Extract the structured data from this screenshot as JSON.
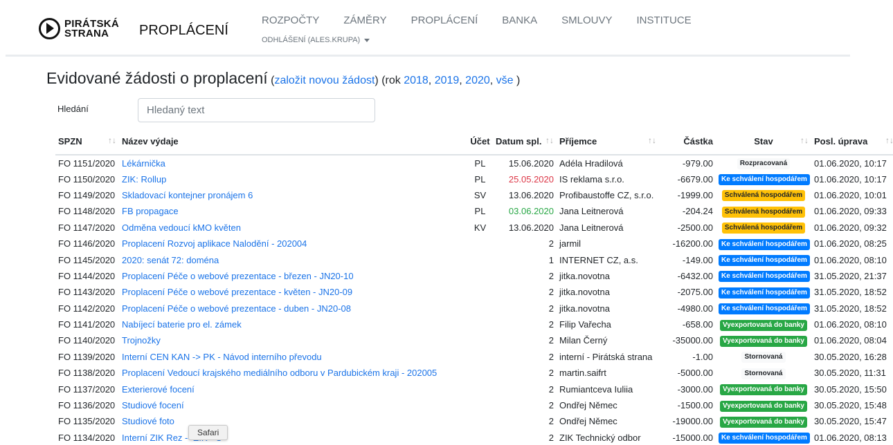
{
  "logo": {
    "line1": "PIRÁTSKÁ",
    "line2": "STRANA"
  },
  "brand": "PROPLÁCENÍ",
  "nav": [
    "ROZPOČTY",
    "ZÁMĚRY",
    "PROPLÁCENÍ",
    "BANKA",
    "SMLOUVY",
    "INSTITUCE"
  ],
  "user_menu": "ODHLÁŠENÍ (ALES.KRUPA)",
  "heading": {
    "title": "Evidované žádosti o proplacení",
    "open": " (",
    "new_link": "založit novou žádost",
    "rok": ") (rok ",
    "y2018": "2018",
    "y2019": "2019",
    "y2020": "2020",
    "all": "vše",
    "close": " )"
  },
  "search": {
    "label": "Hledání",
    "placeholder": "Hledaný text"
  },
  "columns": [
    "SPZN",
    "Název výdaje",
    "Účet",
    "Datum spl.",
    "Příjemce",
    "Částka",
    "Stav",
    "Posl. úprava"
  ],
  "rows": [
    {
      "spzn": "FO 1151/2020",
      "nazev": "Lékárnička",
      "ucet": "PL",
      "datum": "15.06.2020",
      "datum_color": "normal",
      "prijemce": "Adéla Hradilová",
      "castka": "-979.00",
      "stav": "Rozpracovaná",
      "stav_style": "gray",
      "posl": "01.06.2020, 10:17"
    },
    {
      "spzn": "FO 1150/2020",
      "nazev": "ZIK: Rollup",
      "ucet": "PL",
      "datum": "25.05.2020",
      "datum_color": "red",
      "prijemce": "IS reklama s.r.o.",
      "castka": "-6679.00",
      "stav": "Ke schválení hospodářem",
      "stav_style": "blue",
      "posl": "01.06.2020, 10:17"
    },
    {
      "spzn": "FO 1149/2020",
      "nazev": "Skladovací kontejner pronájem 6",
      "ucet": "SV",
      "datum": "13.06.2020",
      "datum_color": "normal",
      "prijemce": "Profibaustoffe CZ, s.r.o.",
      "castka": "-1999.00",
      "stav": "Schválená hospodářem",
      "stav_style": "yellow",
      "posl": "01.06.2020, 10:01"
    },
    {
      "spzn": "FO 1148/2020",
      "nazev": "FB propagace",
      "ucet": "PL",
      "datum": "03.06.2020",
      "datum_color": "green",
      "prijemce": "Jana Leitnerová",
      "castka": "-204.24",
      "stav": "Schválená hospodářem",
      "stav_style": "yellow",
      "posl": "01.06.2020, 09:33"
    },
    {
      "spzn": "FO 1147/2020",
      "nazev": "Odměna vedoucí kMO květen",
      "ucet": "KV",
      "datum": "13.06.2020",
      "datum_color": "normal",
      "prijemce": "Jana Leitnerová",
      "castka": "-2500.00",
      "stav": "Schválená hospodářem",
      "stav_style": "yellow",
      "posl": "01.06.2020, 09:32"
    },
    {
      "spzn": "FO 1146/2020",
      "nazev": "Proplacení Rozvoj aplikace Nalodění - 202004",
      "ucet": "",
      "datum": "2",
      "datum_color": "normal",
      "prijemce": "jarmil",
      "castka": "-16200.00",
      "stav": "Ke schválení hospodářem",
      "stav_style": "blue",
      "posl": "01.06.2020, 08:25"
    },
    {
      "spzn": "FO 1145/2020",
      "nazev": "2020: senát 72: doména",
      "ucet": "",
      "datum": "1",
      "datum_color": "normal",
      "prijemce": "INTERNET CZ, a.s.",
      "castka": "-149.00",
      "stav": "Ke schválení hospodářem",
      "stav_style": "blue",
      "posl": "01.06.2020, 08:10"
    },
    {
      "spzn": "FO 1144/2020",
      "nazev": "Proplacení Péče o webové prezentace - březen - JN20-10",
      "ucet": "",
      "datum": "2",
      "datum_color": "normal",
      "prijemce": "jitka.novotna",
      "castka": "-6432.00",
      "stav": "Ke schválení hospodářem",
      "stav_style": "blue",
      "posl": "31.05.2020, 21:37"
    },
    {
      "spzn": "FO 1143/2020",
      "nazev": "Proplacení Péče o webové prezentace - květen - JN20-09",
      "ucet": "",
      "datum": "2",
      "datum_color": "normal",
      "prijemce": "jitka.novotna",
      "castka": "-2075.00",
      "stav": "Ke schválení hospodářem",
      "stav_style": "blue",
      "posl": "31.05.2020, 18:52"
    },
    {
      "spzn": "FO 1142/2020",
      "nazev": "Proplacení Péče o webové prezentace - duben - JN20-08",
      "ucet": "",
      "datum": "2",
      "datum_color": "normal",
      "prijemce": "jitka.novotna",
      "castka": "-4980.00",
      "stav": "Ke schválení hospodářem",
      "stav_style": "blue",
      "posl": "31.05.2020, 18:52"
    },
    {
      "spzn": "FO 1141/2020",
      "nazev": "Nabíjecí baterie pro el. zámek",
      "ucet": "",
      "datum": "2",
      "datum_color": "normal",
      "prijemce": "Filip Vařecha",
      "castka": "-658.00",
      "stav": "Vyexportovaná do banky",
      "stav_style": "green",
      "posl": "01.06.2020, 08:10"
    },
    {
      "spzn": "FO 1140/2020",
      "nazev": "Trojnožky",
      "ucet": "",
      "datum": "2",
      "datum_color": "normal",
      "prijemce": "Milan Černý",
      "castka": "-35000.00",
      "stav": "Vyexportovaná do banky",
      "stav_style": "green",
      "posl": "01.06.2020, 08:04"
    },
    {
      "spzn": "FO 1139/2020",
      "nazev": "Interní CEN KAN -> PK - Návod interního převodu",
      "ucet": "",
      "datum": "2",
      "datum_color": "normal",
      "prijemce": "interní - Pirátská strana",
      "castka": "-1.00",
      "stav": "Stornovaná",
      "stav_style": "gray",
      "posl": "30.05.2020, 16:28"
    },
    {
      "spzn": "FO 1138/2020",
      "nazev": "Proplacení Vedoucí krajského mediálního odboru v Pardubickém kraji - 202005",
      "ucet": "",
      "datum": "2",
      "datum_color": "normal",
      "prijemce": "martin.saifrt",
      "castka": "-5000.00",
      "stav": "Stornovaná",
      "stav_style": "gray",
      "posl": "30.05.2020, 11:31"
    },
    {
      "spzn": "FO 1137/2020",
      "nazev": "Exterierové focení",
      "ucet": "",
      "datum": "2",
      "datum_color": "normal",
      "prijemce": "Rumiantceva Iuliia",
      "castka": "-3000.00",
      "stav": "Vyexportovaná do banky",
      "stav_style": "green",
      "posl": "30.05.2020, 15:50"
    },
    {
      "spzn": "FO 1136/2020",
      "nazev": "Studiové focení",
      "ucet": "",
      "datum": "2",
      "datum_color": "normal",
      "prijemce": "Ondřej Němec",
      "castka": "-1500.00",
      "stav": "Vyexportovaná do banky",
      "stav_style": "green",
      "posl": "30.05.2020, 15:48"
    },
    {
      "spzn": "FO 1135/2020",
      "nazev": "Studiové foto",
      "ucet": "",
      "datum": "2",
      "datum_color": "normal",
      "prijemce": "Ondřej Němec",
      "castka": "-19000.00",
      "stav": "Vyexportovaná do banky",
      "stav_style": "green",
      "posl": "30.05.2020, 15:47"
    },
    {
      "spzn": "FO 1134/2020",
      "nazev": "Interní ZIK Rez -- ZIK - O",
      "ucet": "",
      "datum": "2",
      "datum_color": "normal",
      "prijemce": "ZIK Technický odbor",
      "castka": "-15000.00",
      "stav": "Ke schválení hospodářem",
      "stav_style": "blue",
      "posl": "01.06.2020, 08:13"
    }
  ],
  "tooltip": "Safari"
}
